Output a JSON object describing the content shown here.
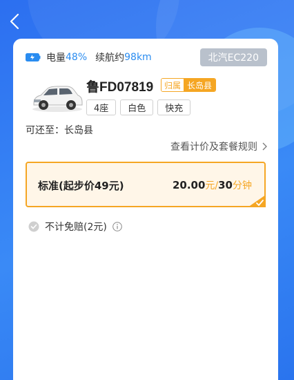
{
  "header": {
    "back_icon": "chevron-left-icon"
  },
  "battery": {
    "label": "电量",
    "percent": "48%",
    "range_label": "续航约",
    "range_value": "98km"
  },
  "vehicle": {
    "model": "北汽EC220",
    "plate": "鲁FD07819",
    "belong_label": "归属",
    "belong_value": "长岛县",
    "tags": [
      "4座",
      "白色",
      "快充"
    ]
  },
  "return_to": "可还至：长岛县",
  "rules_link": "查看计价及套餐规则",
  "plan": {
    "name": "标准(起步价49元)",
    "price": "20.00",
    "price_unit": "元/",
    "minutes": "30",
    "minutes_unit": "分钟",
    "selected": true
  },
  "insurance": {
    "label": "不计免赔(2元)"
  },
  "colors": {
    "accent": "#2a8cf0",
    "orange": "#f5a623",
    "badge_gray": "#b9c1cc"
  }
}
